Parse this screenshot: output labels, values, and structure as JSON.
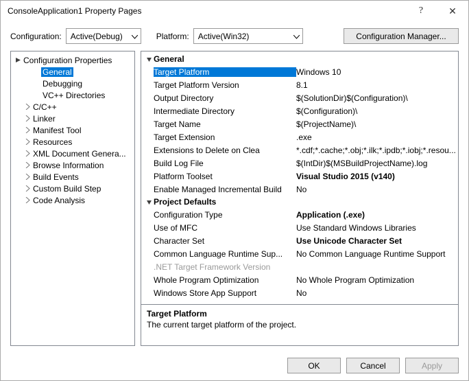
{
  "window": {
    "title": "ConsoleApplication1 Property Pages",
    "help_icon": "?",
    "close_icon": "✕"
  },
  "toolbar": {
    "configuration_label": "Configuration:",
    "configuration_value": "Active(Debug)",
    "platform_label": "Platform:",
    "platform_value": "Active(Win32)",
    "config_manager_label": "Configuration Manager..."
  },
  "tree": {
    "root": "Configuration Properties",
    "items": [
      {
        "label": "General",
        "indent": 2,
        "expander": "",
        "selected": true
      },
      {
        "label": "Debugging",
        "indent": 2,
        "expander": ""
      },
      {
        "label": "VC++ Directories",
        "indent": 2,
        "expander": ""
      },
      {
        "label": "C/C++",
        "indent": 1,
        "expander": "closed"
      },
      {
        "label": "Linker",
        "indent": 1,
        "expander": "closed"
      },
      {
        "label": "Manifest Tool",
        "indent": 1,
        "expander": "closed"
      },
      {
        "label": "Resources",
        "indent": 1,
        "expander": "closed"
      },
      {
        "label": "XML Document Genera...",
        "indent": 1,
        "expander": "closed"
      },
      {
        "label": "Browse Information",
        "indent": 1,
        "expander": "closed"
      },
      {
        "label": "Build Events",
        "indent": 1,
        "expander": "closed"
      },
      {
        "label": "Custom Build Step",
        "indent": 1,
        "expander": "closed"
      },
      {
        "label": "Code Analysis",
        "indent": 1,
        "expander": "closed"
      }
    ]
  },
  "groups": [
    {
      "name": "General",
      "rows": [
        {
          "name": "Target Platform",
          "value": "Windows 10",
          "selected": true
        },
        {
          "name": "Target Platform Version",
          "value": "8.1"
        },
        {
          "name": "Output Directory",
          "value": "$(SolutionDir)$(Configuration)\\"
        },
        {
          "name": "Intermediate Directory",
          "value": "$(Configuration)\\"
        },
        {
          "name": "Target Name",
          "value": "$(ProjectName)\\"
        },
        {
          "name": "Target Extension",
          "value": ".exe"
        },
        {
          "name": "Extensions to Delete on Clea",
          "value": "*.cdf;*.cache;*.obj;*.ilk;*.ipdb;*.iobj;*.resou..."
        },
        {
          "name": "Build Log File",
          "value": "$(IntDir)$(MSBuildProjectName).log"
        },
        {
          "name": "Platform Toolset",
          "value": "Visual Studio 2015 (v140)",
          "bold": true
        },
        {
          "name": "Enable Managed Incremental Build",
          "value": "No"
        }
      ]
    },
    {
      "name": "Project Defaults",
      "rows": [
        {
          "name": "Configuration Type",
          "value": "Application (.exe)",
          "bold": true
        },
        {
          "name": "Use of MFC",
          "value": "Use Standard Windows Libraries"
        },
        {
          "name": "Character Set",
          "value": "Use Unicode Character Set",
          "bold": true
        },
        {
          "name": "Common Language Runtime Sup...",
          "value": "No Common Language Runtime Support"
        },
        {
          "name": ".NET Target Framework Version",
          "value": "",
          "dim": true
        },
        {
          "name": "Whole Program Optimization",
          "value": "No Whole Program Optimization"
        },
        {
          "name": "Windows Store App Support",
          "value": "No"
        }
      ]
    }
  ],
  "description": {
    "title": "Target Platform",
    "text": "The current target platform of the project."
  },
  "footer": {
    "ok": "OK",
    "cancel": "Cancel",
    "apply": "Apply"
  }
}
